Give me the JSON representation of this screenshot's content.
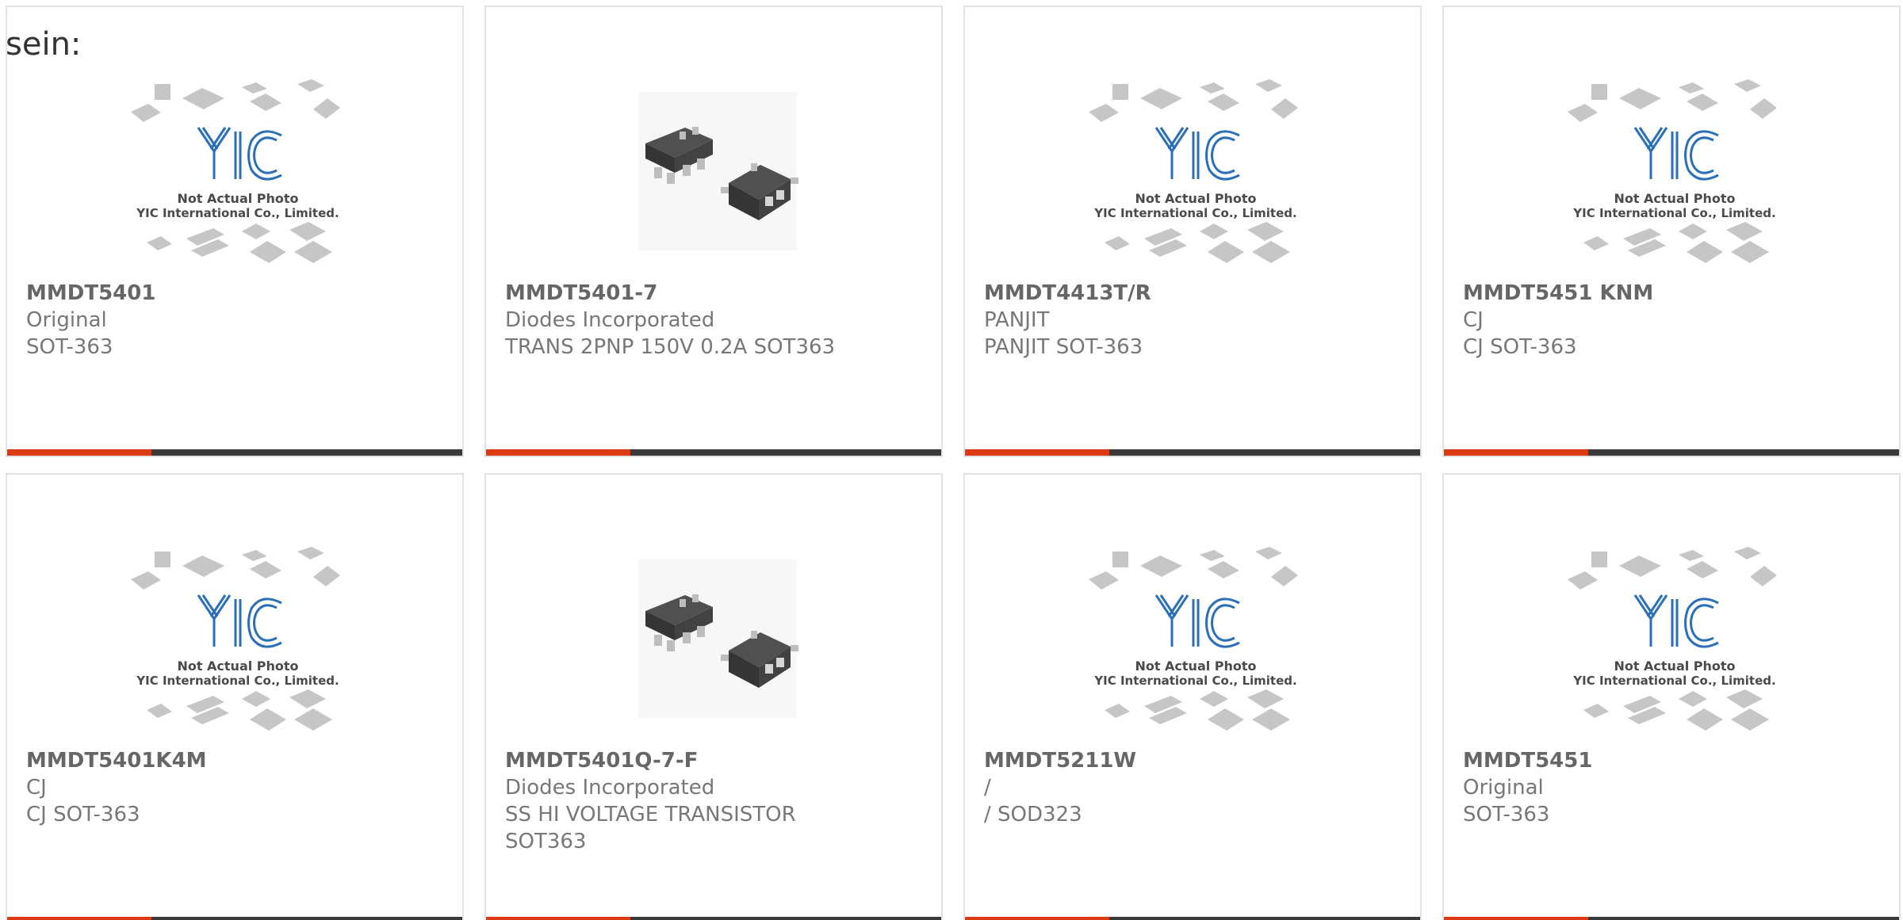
{
  "lead_text": "sein:",
  "placeholder_caption": {
    "line1": "Not Actual Photo",
    "line2": "YIC International Co., Limited."
  },
  "brand_logo_text": "YIC",
  "colors": {
    "accent": "#dc3a12",
    "bar_dark": "#3a3a3a",
    "logo_blue": "#2a6fb7",
    "text": "#777777"
  },
  "products": [
    {
      "part": "MMDT5401",
      "manufacturer": "Original",
      "description": "SOT-363",
      "image": "not-actual-photo-placeholder"
    },
    {
      "part": "MMDT5401-7",
      "manufacturer": "Diodes Incorporated",
      "description": "TRANS 2PNP 150V 0.2A SOT363",
      "image": "sot363-package-photo"
    },
    {
      "part": "MMDT4413T/R",
      "manufacturer": "PANJIT",
      "description": "PANJIT SOT-363",
      "image": "not-actual-photo-placeholder"
    },
    {
      "part": "MMDT5451 KNM",
      "manufacturer": "CJ",
      "description": "CJ SOT-363",
      "image": "not-actual-photo-placeholder"
    },
    {
      "part": "MMDT5401K4M",
      "manufacturer": "CJ",
      "description": "CJ SOT-363",
      "image": "not-actual-photo-placeholder"
    },
    {
      "part": "MMDT5401Q-7-F",
      "manufacturer": "Diodes Incorporated",
      "description": "SS HI VOLTAGE TRANSISTOR SOT363",
      "image": "sot363-package-photo"
    },
    {
      "part": "MMDT5211W",
      "manufacturer": "/",
      "description": "/ SOD323",
      "image": "not-actual-photo-placeholder"
    },
    {
      "part": "MMDT5451",
      "manufacturer": "Original",
      "description": "SOT-363",
      "image": "not-actual-photo-placeholder"
    }
  ]
}
